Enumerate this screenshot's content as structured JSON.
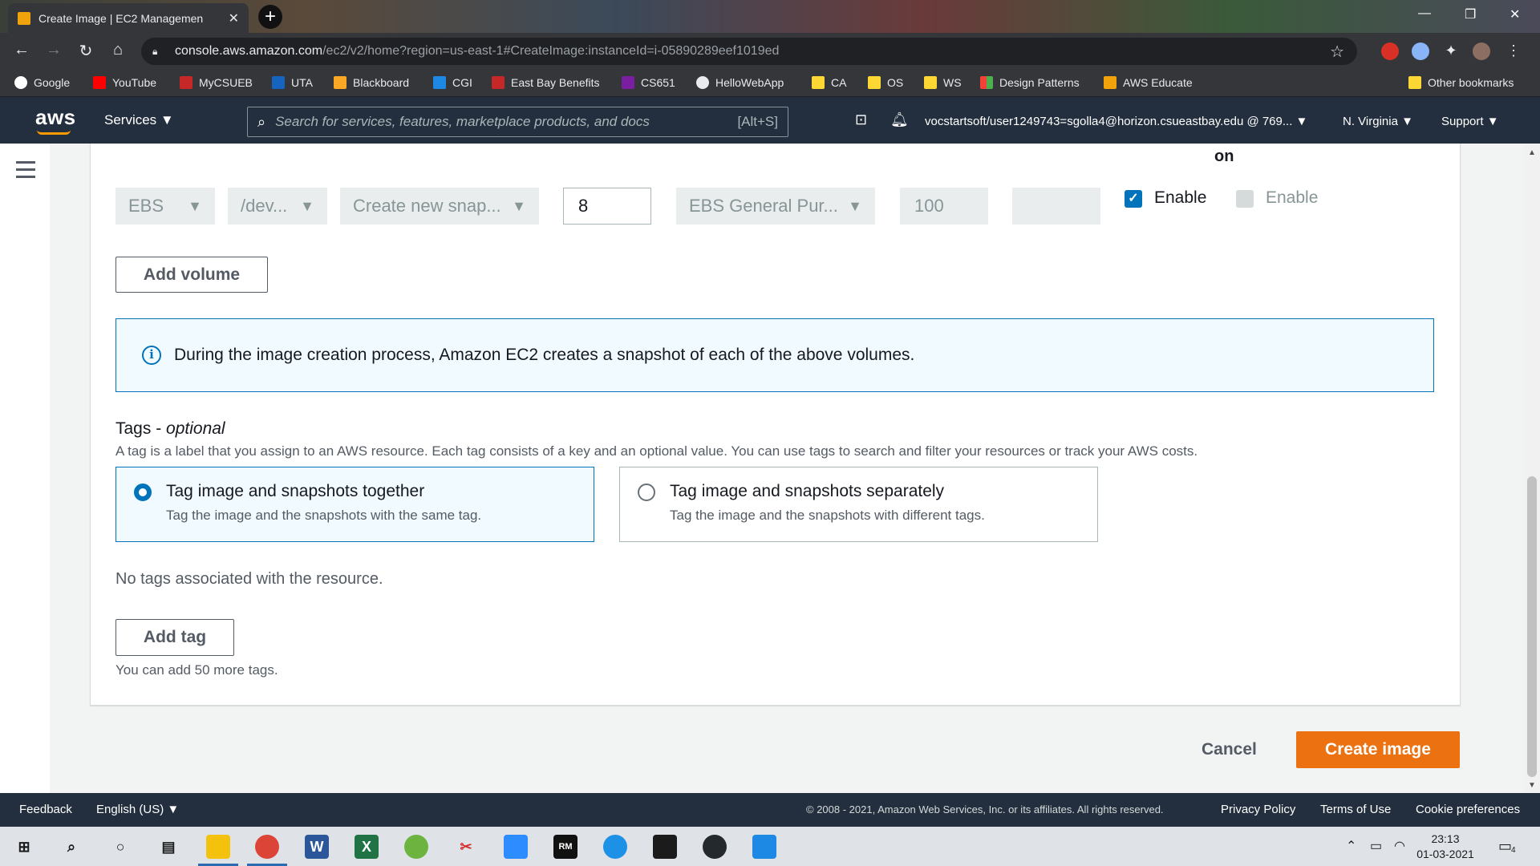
{
  "browser": {
    "tab_title": "Create Image | EC2 Managemen",
    "url_host": "console.aws.amazon.com",
    "url_rest": "/ec2/v2/home?region=us-east-1#CreateImage:instanceId=i-05890289eef1019ed",
    "bookmarks": [
      "Google",
      "YouTube",
      "MyCSUEB",
      "UTA",
      "Blackboard",
      "CGI",
      "East Bay Benefits",
      "CS651",
      "HelloWebApp",
      "CA",
      "OS",
      "WS",
      "Design Patterns",
      "AWS Educate"
    ],
    "other_bookmarks": "Other bookmarks"
  },
  "aws_header": {
    "logo": "aws",
    "services": "Services ▼",
    "search_placeholder": "Search for services, features, marketplace products, and docs",
    "search_shortcut": "[Alt+S]",
    "account": "vocstartsoft/user1249743=sgolla4@horizon.csueastbay.edu @ 769... ▼",
    "region": "N. Virginia ▼",
    "support": "Support ▼"
  },
  "volume_row": {
    "column_header_fragment": "on",
    "volume_type": "EBS",
    "device": "/dev...",
    "snapshot": "Create new snap...",
    "size": "8",
    "ebs_type": "EBS General Pur...",
    "iops": "100",
    "throughput": "",
    "delete_on_termination_label": "Enable",
    "encrypted_label": "Enable"
  },
  "add_volume_button": "Add volume",
  "info_message": "During the image creation process, Amazon EC2 creates a snapshot of each of the above volumes.",
  "tags": {
    "heading": "Tags - ",
    "heading_optional": "optional",
    "description": "A tag is a label that you assign to an AWS resource. Each tag consists of a key and an optional value. You can use tags to search and filter your resources or track your AWS costs.",
    "options": [
      {
        "title": "Tag image and snapshots together",
        "desc": "Tag the image and the snapshots with the same tag."
      },
      {
        "title": "Tag image and snapshots separately",
        "desc": "Tag the image and the snapshots with different tags."
      }
    ],
    "empty_text": "No tags associated with the resource.",
    "add_tag_button": "Add tag",
    "remaining_text": "You can add 50 more tags."
  },
  "actions": {
    "cancel": "Cancel",
    "create": "Create image"
  },
  "footer": {
    "feedback": "Feedback",
    "language": "English (US) ▼",
    "copyright": "© 2008 - 2021, Amazon Web Services, Inc. or its affiliates. All rights reserved.",
    "privacy": "Privacy Policy",
    "terms": "Terms of Use",
    "cookies": "Cookie preferences"
  },
  "taskbar": {
    "time": "23:13",
    "date": "01-03-2021",
    "notification_count": "4"
  },
  "colors": {
    "aws_nav": "#232f3e",
    "primary_button": "#ec7211",
    "info_blue": "#0073bb"
  }
}
